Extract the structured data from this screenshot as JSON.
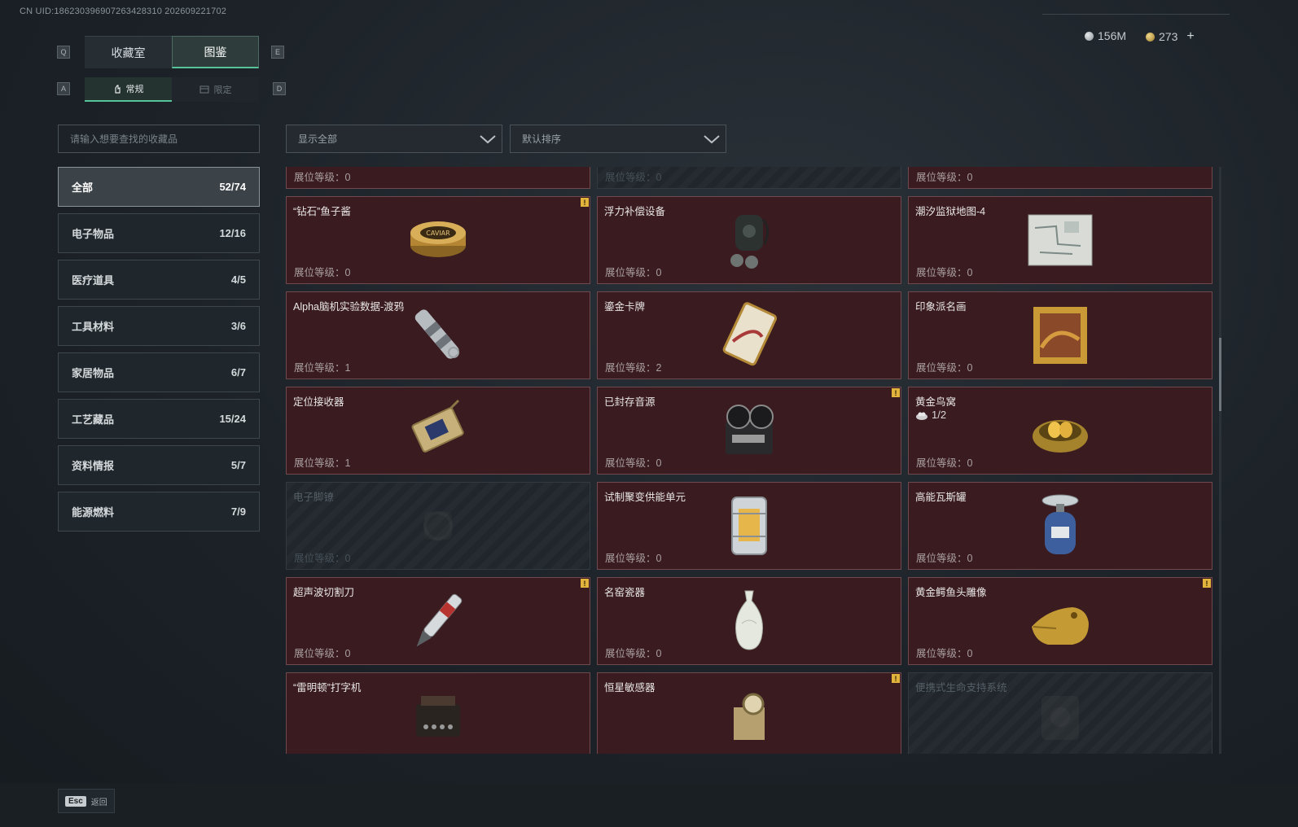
{
  "uid": "CN UID:18623039690726342831​0 202609221702",
  "keys": {
    "q": "Q",
    "e": "E",
    "a": "A",
    "d": "D"
  },
  "tabs": [
    {
      "label": "收藏室",
      "active": false
    },
    {
      "label": "图鉴",
      "active": true
    }
  ],
  "subtabs": [
    {
      "label": "常规",
      "active": true,
      "icon": "hand-icon"
    },
    {
      "label": "限定",
      "active": false,
      "icon": "card-icon"
    }
  ],
  "currency": {
    "silver": "156M",
    "gold": "273",
    "plus": "+"
  },
  "search": {
    "placeholder": "请输入想要查找的收藏品"
  },
  "filters": {
    "show": "显示全部",
    "sort": "默认排序"
  },
  "categories": [
    {
      "label": "全部",
      "count": "52/74",
      "active": true
    },
    {
      "label": "电子物品",
      "count": "12/16"
    },
    {
      "label": "医疗道具",
      "count": "4/5"
    },
    {
      "label": "工具材料",
      "count": "3/6"
    },
    {
      "label": "家居物品",
      "count": "6/7"
    },
    {
      "label": "工艺藏品",
      "count": "15/24"
    },
    {
      "label": "资料情报",
      "count": "5/7"
    },
    {
      "label": "能源燃料",
      "count": "7/9"
    }
  ],
  "items": [
    {
      "name": "",
      "level": "展位等级：0",
      "locked": false,
      "icon": "armillary-sphere-icon"
    },
    {
      "name": "",
      "level": "展位等级：0",
      "locked": true,
      "icon": "crate-icon"
    },
    {
      "name": "",
      "level": "展位等级：0",
      "locked": false,
      "icon": "generator-icon"
    },
    {
      "name": "“钻石”鱼子酱",
      "level": "展位等级：0",
      "locked": false,
      "badge": "!",
      "icon": "caviar-tin-icon"
    },
    {
      "name": "浮力补偿设备",
      "level": "展位等级：0",
      "locked": false,
      "icon": "diving-gear-icon"
    },
    {
      "name": "潮汐监狱地图-4",
      "level": "展位等级：0",
      "locked": false,
      "icon": "map-icon"
    },
    {
      "name": "Alpha脑机实验数据-渡鸦",
      "level": "展位等级：1",
      "locked": false,
      "icon": "data-capsule-icon"
    },
    {
      "name": "鎏金卡牌",
      "level": "展位等级：2",
      "locked": false,
      "icon": "gilded-card-icon"
    },
    {
      "name": "印象派名画",
      "level": "展位等级：0",
      "locked": false,
      "icon": "painting-icon"
    },
    {
      "name": "定位接收器",
      "level": "展位等级：1",
      "locked": false,
      "icon": "receiver-icon"
    },
    {
      "name": "已封存音源",
      "level": "展位等级：0",
      "locked": false,
      "badge": "!",
      "icon": "reel-recorder-icon"
    },
    {
      "name": "黄金鸟窝",
      "sub": "1/2",
      "level": "展位等级：0",
      "locked": false,
      "icon": "golden-nest-icon"
    },
    {
      "name": "电子脚镣",
      "level": "展位等级：0",
      "locked": true,
      "icon": "ankle-monitor-icon"
    },
    {
      "name": "试制聚变供能单元",
      "level": "展位等级：0",
      "locked": false,
      "icon": "fusion-cell-icon"
    },
    {
      "name": "高能瓦斯罐",
      "level": "展位等级：0",
      "locked": false,
      "icon": "gas-canister-icon"
    },
    {
      "name": "超声波切割刀",
      "level": "展位等级：0",
      "locked": false,
      "badge": "!",
      "icon": "ultrasonic-cutter-icon"
    },
    {
      "name": "名窑瓷器",
      "level": "展位等级：0",
      "locked": false,
      "icon": "porcelain-vase-icon"
    },
    {
      "name": "黄金鳄鱼头雕像",
      "level": "展位等级：0",
      "locked": false,
      "badge": "!",
      "icon": "crocodile-statue-icon"
    },
    {
      "name": "“雷明顿”打字机",
      "level": "",
      "locked": false,
      "icon": "typewriter-icon"
    },
    {
      "name": "恒星敏感器",
      "level": "",
      "locked": false,
      "badge": "!",
      "icon": "star-sensor-icon"
    },
    {
      "name": "便携式生命支持系统",
      "level": "",
      "locked": true,
      "icon": "life-support-icon"
    }
  ],
  "footer": {
    "esc_key": "Esc",
    "esc_label": "返回"
  },
  "colors": {
    "accent": "#56c49b",
    "card_bg": "#3a1c20",
    "badge": "#e2b43c"
  }
}
